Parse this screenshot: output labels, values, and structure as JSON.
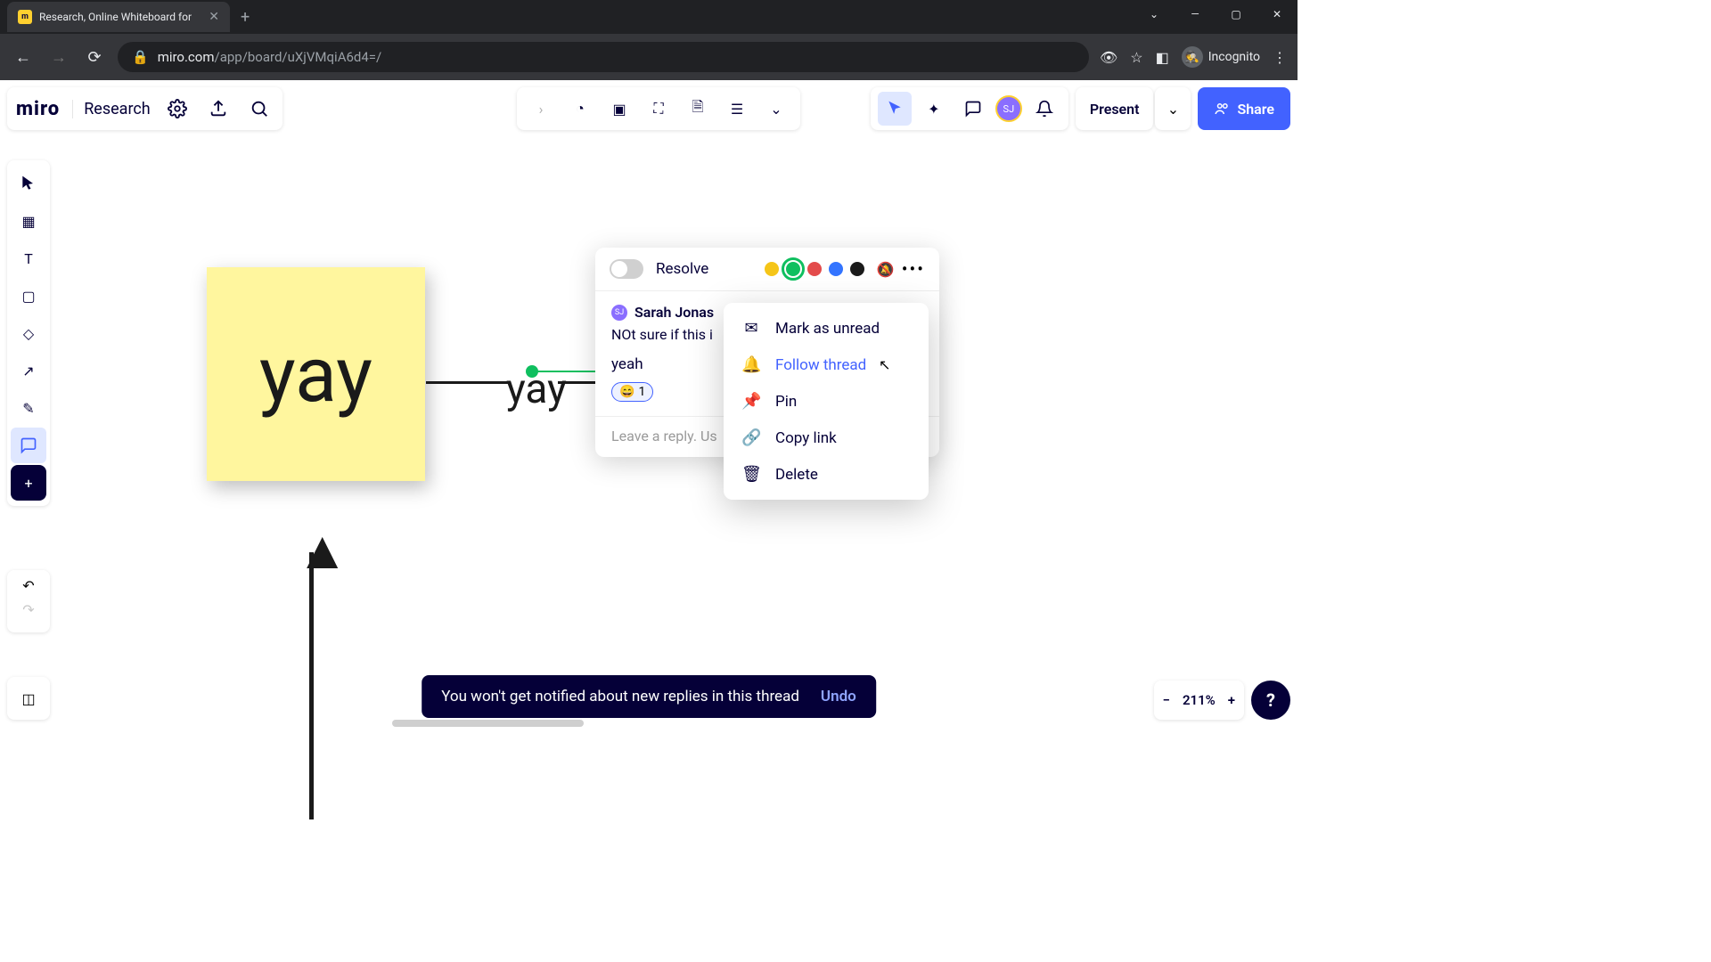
{
  "browser": {
    "tab_title": "Research, Online Whiteboard for",
    "url_secure": "miro.com",
    "url_path": "/app/board/uXjVMqiA6d4=/",
    "incognito": "Incognito"
  },
  "header": {
    "logo": "miro",
    "board_name": "Research",
    "present": "Present",
    "share": "Share",
    "avatar_initials": "SJ"
  },
  "canvas": {
    "sticky_text": "yay",
    "label_text": "yay"
  },
  "comment": {
    "resolve": "Resolve",
    "author": "Sarah Jonas",
    "author_initials": "SJ",
    "body": "NOt sure if this i",
    "reply": "yeah",
    "reaction_emoji": "😄",
    "reaction_count": "1",
    "reply_placeholder": "Leave a reply. Us",
    "colors": {
      "yellow": "#f5c518",
      "green": "#0fbf5f",
      "red": "#e34b4b",
      "blue": "#3374ff",
      "black": "#1a1a1a"
    }
  },
  "context_menu": {
    "mark_unread": "Mark as unread",
    "follow_thread": "Follow thread",
    "pin": "Pin",
    "copy_link": "Copy link",
    "delete": "Delete"
  },
  "toast": {
    "message": "You won't get notified about new replies in this thread",
    "undo": "Undo"
  },
  "zoom": {
    "level": "211%"
  }
}
